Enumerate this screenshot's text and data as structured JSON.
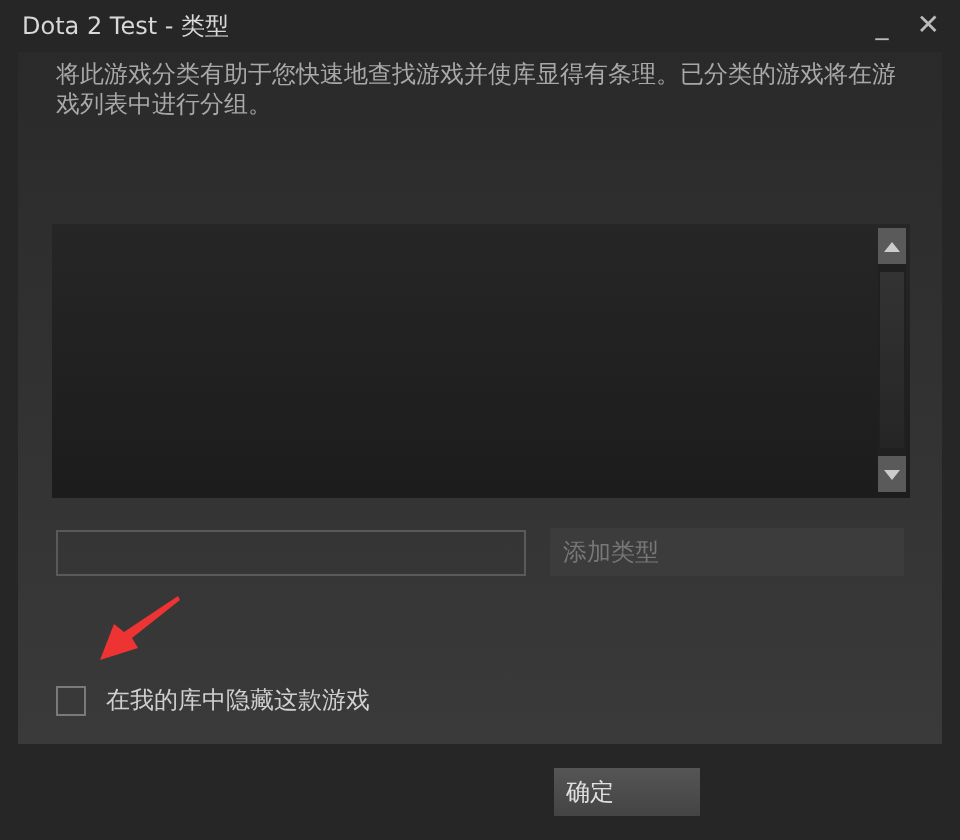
{
  "window": {
    "title": "Dota 2 Test - 类型",
    "buttons": [
      "_",
      "✕"
    ]
  },
  "description": "将此游戏分类有助于您快速地查找游戏并使库显得有条理。已分类的游戏将在游戏列表中进行分组。",
  "add_button": {
    "label": "添加类型",
    "disabled": true
  },
  "hide_checkbox": {
    "label": "在我的库中隐藏这款游戏",
    "checked": false
  },
  "ok_button": {
    "label": "确定"
  }
}
